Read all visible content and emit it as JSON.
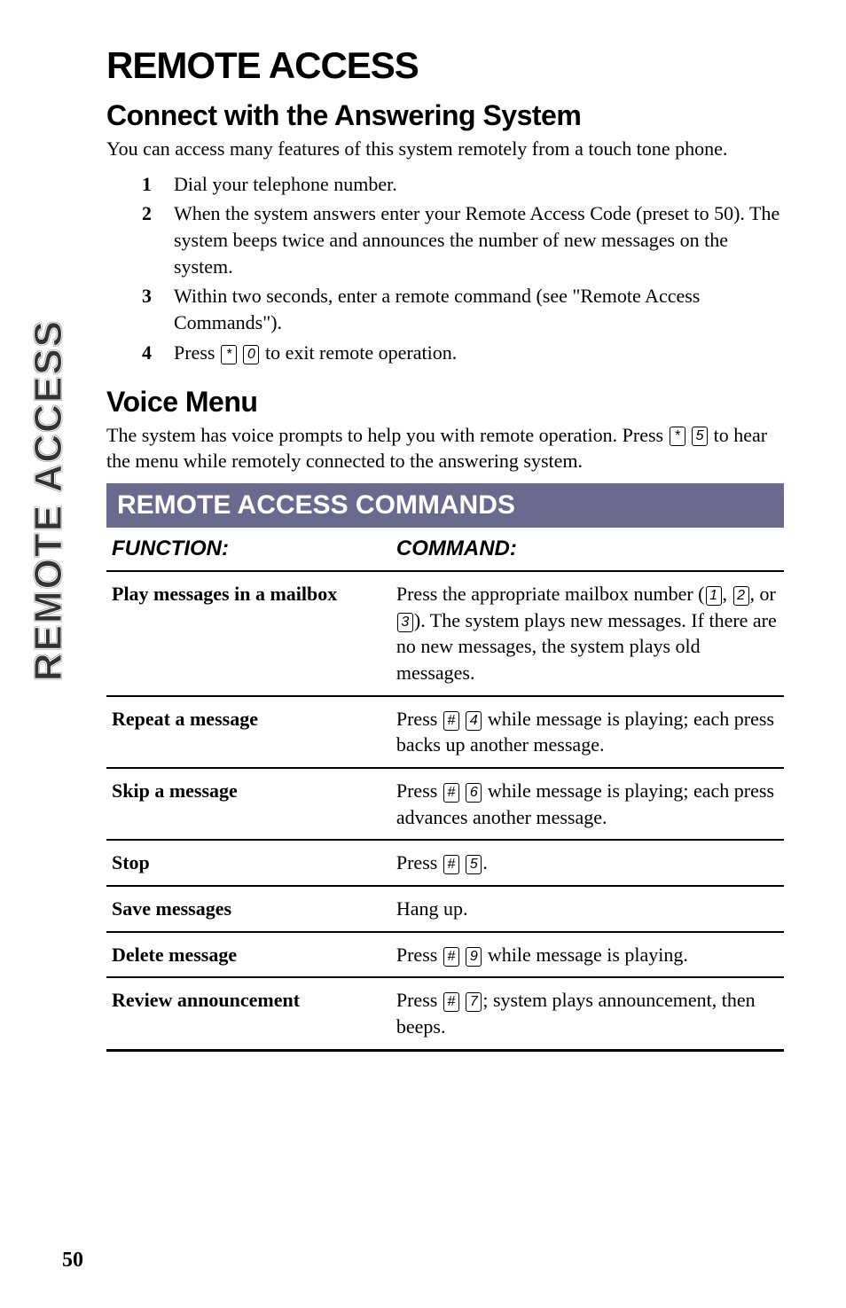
{
  "sideTab": "REMOTE ACCESS",
  "title": "REMOTE ACCESS",
  "section1": {
    "heading": "Connect with the Answering System",
    "intro": "You can access many features of this system remotely from a touch tone phone.",
    "steps": [
      {
        "num": "1",
        "text": "Dial your telephone number."
      },
      {
        "num": "2",
        "text": "When the system answers enter your Remote Access Code (preset to 50). The system beeps twice and announces the number of new messages on the system."
      },
      {
        "num": "3",
        "text": "Within two seconds, enter a remote command (see \"Remote Access Commands\")."
      },
      {
        "num": "4",
        "prefix": "Press ",
        "keys": [
          "*",
          "0"
        ],
        "suffix": " to exit remote operation."
      }
    ]
  },
  "section2": {
    "heading": "Voice Menu",
    "introPrefix": "The system has voice prompts to help you with remote operation. Press ",
    "introKeys": [
      "*",
      "5"
    ],
    "introSuffix": " to hear the menu while remotely connected to the answering system."
  },
  "commands": {
    "header": "REMOTE ACCESS COMMANDS",
    "col1": "FUNCTION:",
    "col2": "COMMAND:",
    "rows": [
      {
        "fn": "Play messages in a mailbox",
        "cmdParts": [
          {
            "t": "Press the appropriate mailbox number ("
          },
          {
            "k": "1"
          },
          {
            "t": ", "
          },
          {
            "k": "2"
          },
          {
            "t": ", or "
          },
          {
            "k": "3"
          },
          {
            "t": "). The system plays new messages.  If there are no new messages, the system plays old messages."
          }
        ]
      },
      {
        "fn": "Repeat a message",
        "cmdParts": [
          {
            "t": "Press "
          },
          {
            "k": "#"
          },
          {
            "t": " "
          },
          {
            "k": "4"
          },
          {
            "t": " while message is playing; each press backs up another message."
          }
        ]
      },
      {
        "fn": "Skip a message",
        "cmdParts": [
          {
            "t": "Press "
          },
          {
            "k": "#"
          },
          {
            "t": " "
          },
          {
            "k": "6"
          },
          {
            "t": " while message is playing; each press advances another message."
          }
        ]
      },
      {
        "fn": "Stop",
        "cmdParts": [
          {
            "t": "Press "
          },
          {
            "k": "#"
          },
          {
            "t": " "
          },
          {
            "k": "5"
          },
          {
            "t": "."
          }
        ]
      },
      {
        "fn": "Save messages",
        "cmdParts": [
          {
            "t": "Hang up."
          }
        ]
      },
      {
        "fn": "Delete message",
        "cmdParts": [
          {
            "t": "Press "
          },
          {
            "k": "#"
          },
          {
            "t": " "
          },
          {
            "k": "9"
          },
          {
            "t": " while message is playing."
          }
        ]
      },
      {
        "fn": "Review announcement",
        "cmdParts": [
          {
            "t": "Press "
          },
          {
            "k": "#"
          },
          {
            "t": " "
          },
          {
            "k": "7"
          },
          {
            "t": "; system plays announcement, then beeps."
          }
        ]
      }
    ]
  },
  "pageNumber": "50"
}
